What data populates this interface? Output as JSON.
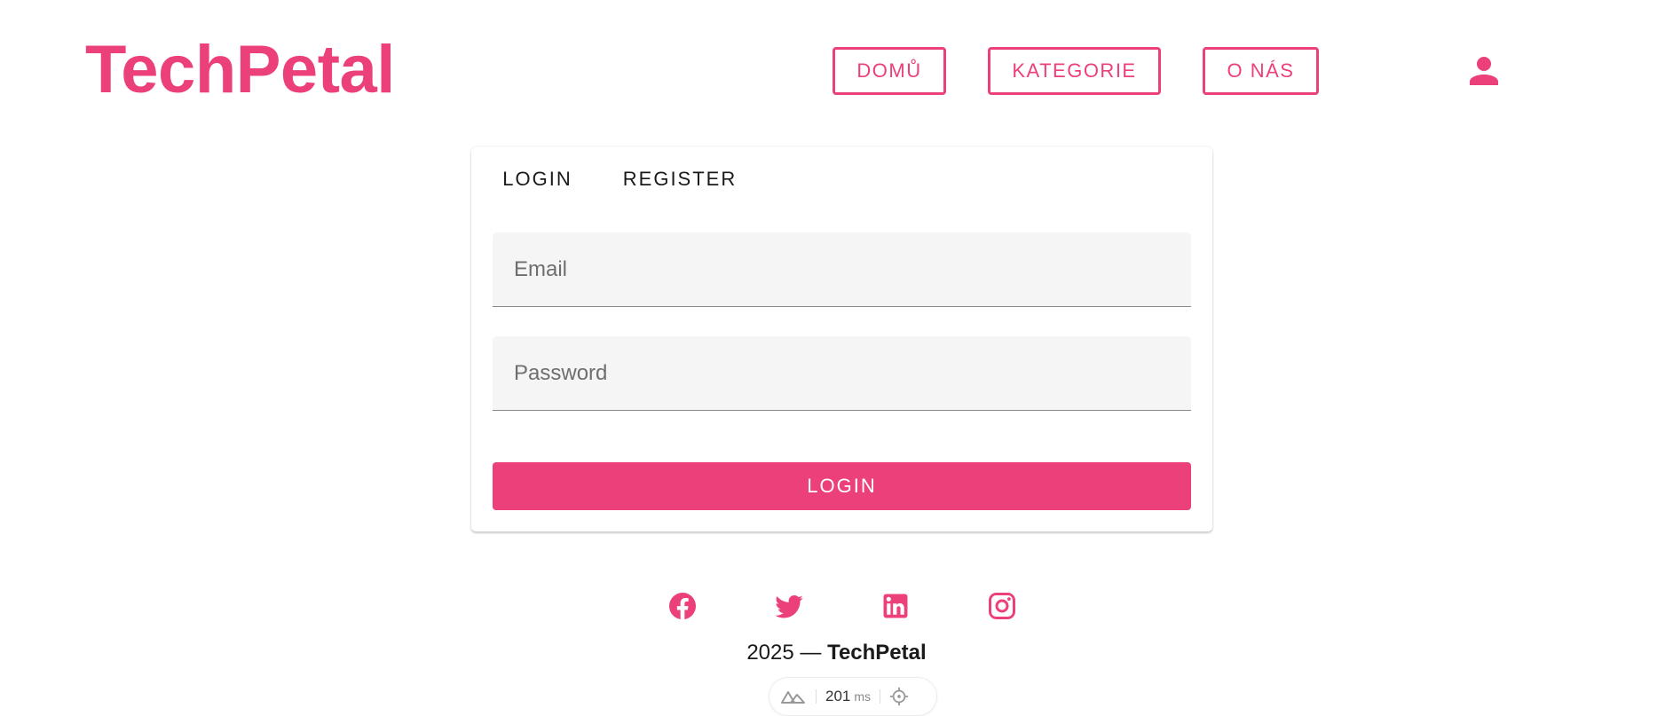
{
  "header": {
    "logo": "TechPetal",
    "nav": [
      {
        "label": "DOMŮ"
      },
      {
        "label": "KATEGORIE"
      },
      {
        "label": "O NÁS"
      }
    ],
    "account_icon": "account-icon"
  },
  "auth_card": {
    "tabs": [
      {
        "label": "LOGIN",
        "active": true
      },
      {
        "label": "REGISTER",
        "active": false
      }
    ],
    "email": {
      "value": "",
      "placeholder": "Email"
    },
    "password": {
      "value": "",
      "placeholder": "Password"
    },
    "submit_label": "LOGIN"
  },
  "footer": {
    "social_icons": [
      "facebook-icon",
      "twitter-icon",
      "linkedin-icon",
      "instagram-icon"
    ],
    "year": "2025",
    "separator": "—",
    "brand": "TechPetal"
  },
  "devtools": {
    "render_time": "201",
    "unit": "ms"
  },
  "colors": {
    "accent": "#ec407a",
    "field_bg": "#f5f5f5",
    "text": "#1a1a1a"
  }
}
